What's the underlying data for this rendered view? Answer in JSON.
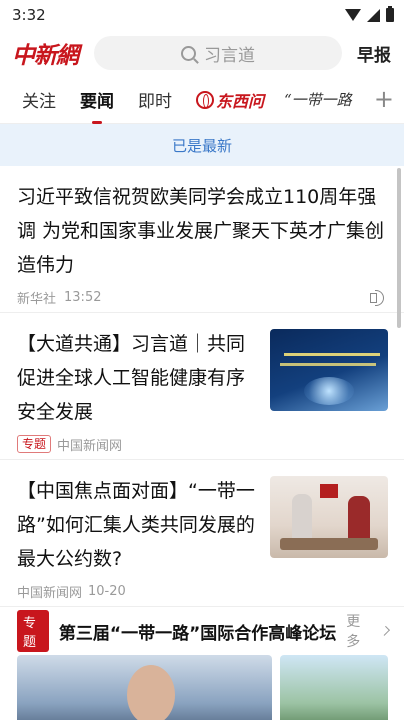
{
  "status": {
    "time": "3:32"
  },
  "header": {
    "logo": "中新網",
    "search_placeholder": "习言道",
    "morning_label": "早报"
  },
  "tabs": [
    {
      "label": "关注"
    },
    {
      "label": "要闻"
    },
    {
      "label": "即时"
    },
    {
      "label": "东西问"
    },
    {
      "label": "“一带一路"
    }
  ],
  "refresh_text": "已是最新",
  "articles": [
    {
      "title": "习近平致信祝贺欧美同学会成立110周年强调 为党和国家事业发展广聚天下英才广集创造伟力",
      "source": "新华社",
      "time": "13:52"
    },
    {
      "title": "【大道共通】习言道｜共同促进全球人工智能健康有序安全发展",
      "tag": "专题",
      "source": "中国新闻网"
    },
    {
      "title": "【中国焦点面对面】“一带一路”如何汇集人类共同发展的最大公约数?",
      "source": "中国新闻网",
      "time": "10-20"
    }
  ],
  "topic": {
    "badge": "专题",
    "title": "第三届“一带一路”国际合作高峰论坛",
    "more": "更多"
  },
  "colors": {
    "brand_red": "#c8161d",
    "refresh_blue": "#3a78c8"
  }
}
